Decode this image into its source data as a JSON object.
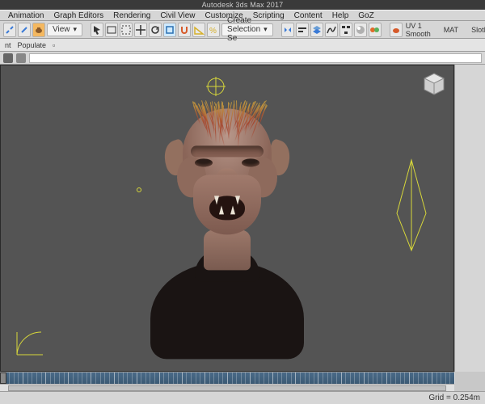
{
  "app": {
    "title": "Autodesk 3ds Max 2017"
  },
  "menus": [
    "Animation",
    "Graph Editors",
    "Rendering",
    "Civil View",
    "Customize",
    "Scripting",
    "Content",
    "Help",
    "GoZ"
  ],
  "toolbar": {
    "a": {
      "view_drop": "View",
      "selset_drop": "Create Selection Se"
    },
    "right": {
      "uv_label": "UV 1 Smooth",
      "mat_label": "MAT",
      "slot_label": "SlotMaterialTest"
    }
  },
  "ribbon": {
    "tab1": "nt",
    "tab2": "Populate"
  },
  "name_editor": {
    "value": ""
  },
  "icons": {
    "unlink": "unlink-icon",
    "link": "link-icon",
    "teapot": "teapot-icon",
    "undo": "undo-icon",
    "redo": "redo-icon",
    "select": "select-arrow-icon",
    "pan": "pan-icon",
    "move": "move-icon",
    "rotate": "rotate-icon",
    "scale": "scale-icon",
    "snap": "snap-icon",
    "angle": "angle-snap-icon",
    "percent": "percent-snap-icon",
    "mirror": "mirror-icon",
    "align": "align-icon",
    "layers": "layers-icon",
    "curve": "curve-editor-icon",
    "schematic": "schematic-view-icon",
    "matslot": "material-editor-icon",
    "render": "render-setup-icon",
    "renderframe": "render-frame-icon"
  },
  "status": {
    "grid": "Grid = 0.254m"
  }
}
